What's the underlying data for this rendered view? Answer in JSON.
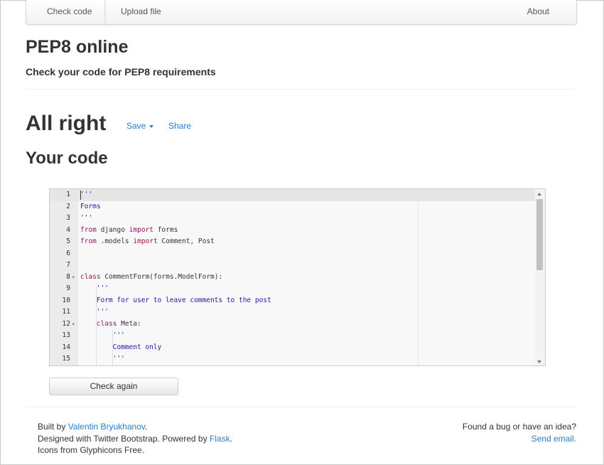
{
  "navbar": {
    "check_code": "Check code",
    "upload_file": "Upload file",
    "about": "About"
  },
  "header": {
    "title": "PEP8 online",
    "subtitle": "Check your code for PEP8 requirements"
  },
  "result": {
    "title": "All right",
    "save_label": "Save",
    "share_label": "Share",
    "code_heading": "Your code"
  },
  "editor": {
    "lines": [
      {
        "n": "1",
        "fold": false,
        "indent": 0,
        "tokens": [
          {
            "t": "'''",
            "c": "str"
          }
        ]
      },
      {
        "n": "2",
        "fold": false,
        "indent": 0,
        "tokens": [
          {
            "t": "Forms",
            "c": "str"
          }
        ]
      },
      {
        "n": "3",
        "fold": false,
        "indent": 0,
        "tokens": [
          {
            "t": "'''",
            "c": "str"
          }
        ]
      },
      {
        "n": "4",
        "fold": false,
        "indent": 0,
        "tokens": [
          {
            "t": "from",
            "c": "kw"
          },
          {
            "t": " django ",
            "c": "plain"
          },
          {
            "t": "import",
            "c": "kw"
          },
          {
            "t": " forms",
            "c": "plain"
          }
        ]
      },
      {
        "n": "5",
        "fold": false,
        "indent": 0,
        "tokens": [
          {
            "t": "from",
            "c": "kw"
          },
          {
            "t": " .models ",
            "c": "plain"
          },
          {
            "t": "import",
            "c": "kw"
          },
          {
            "t": " Comment, Post",
            "c": "plain"
          }
        ]
      },
      {
        "n": "6",
        "fold": false,
        "indent": 0,
        "tokens": []
      },
      {
        "n": "7",
        "fold": false,
        "indent": 0,
        "tokens": []
      },
      {
        "n": "8",
        "fold": true,
        "indent": 0,
        "tokens": [
          {
            "t": "class",
            "c": "kw"
          },
          {
            "t": " CommentForm(forms.ModelForm):",
            "c": "plain"
          }
        ]
      },
      {
        "n": "9",
        "fold": false,
        "indent": 1,
        "tokens": [
          {
            "t": "'''",
            "c": "str"
          }
        ]
      },
      {
        "n": "10",
        "fold": false,
        "indent": 1,
        "tokens": [
          {
            "t": "Form for user to leave comments to the post",
            "c": "str"
          }
        ]
      },
      {
        "n": "11",
        "fold": false,
        "indent": 1,
        "tokens": [
          {
            "t": "'''",
            "c": "str"
          }
        ]
      },
      {
        "n": "12",
        "fold": true,
        "indent": 1,
        "tokens": [
          {
            "t": "class",
            "c": "kw"
          },
          {
            "t": " Meta:",
            "c": "plain"
          }
        ]
      },
      {
        "n": "13",
        "fold": false,
        "indent": 2,
        "tokens": [
          {
            "t": "'''",
            "c": "str"
          }
        ]
      },
      {
        "n": "14",
        "fold": false,
        "indent": 2,
        "tokens": [
          {
            "t": "Comment only",
            "c": "str"
          }
        ]
      },
      {
        "n": "15",
        "fold": false,
        "indent": 2,
        "tokens": [
          {
            "t": "'''",
            "c": "str"
          }
        ]
      }
    ]
  },
  "actions": {
    "check_again": "Check again"
  },
  "footer": {
    "built_by_prefix": "Built by ",
    "author": "Valentin Bryukhanov",
    "built_by_suffix": ".",
    "designed_prefix": "Designed with Twitter Bootstrap. Powered by ",
    "flask": "Flask",
    "designed_suffix": ".",
    "icons_line": "Icons from Glyphicons Free.",
    "bug_text": "Found a bug or have an idea?",
    "send_email": "Send email."
  },
  "colors": {
    "link": "#2a7cc8",
    "keyword": "#93155a",
    "string": "#1a1aa6"
  }
}
